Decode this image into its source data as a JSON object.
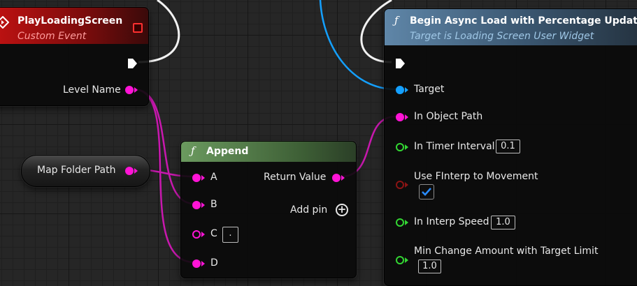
{
  "event_node": {
    "title": "PlayLoadingScreen",
    "subtitle": "Custom Event",
    "output_label": "Level Name"
  },
  "variable_node": {
    "label": "Map Folder Path"
  },
  "append_node": {
    "icon": "function-icon",
    "title": "Append",
    "inputs": [
      "A",
      "B",
      "C",
      "D"
    ],
    "c_value": ".",
    "output_label": "Return Value",
    "add_pin_label": "Add pin"
  },
  "async_node": {
    "icon": "function-icon",
    "title": "Begin Async Load with Percentage Update",
    "subtitle": "Target is Loading Screen User Widget",
    "pins": {
      "target": "Target",
      "object_path": "In Object Path",
      "timer_interval": "In Timer Interval",
      "timer_interval_value": "0.1",
      "use_finterp": "Use FInterp to Movement",
      "use_finterp_checked": true,
      "interp_speed": "In Interp Speed",
      "interp_speed_value": "1.0",
      "min_change": "Min Change Amount with Target Limit",
      "min_change_value": "1.0"
    }
  },
  "colors": {
    "string_pin": "#ff14d6",
    "object_pin": "#14a0ff",
    "float_pin": "#33d633",
    "bool_pin": "#8a1414",
    "event_header": "#b01010",
    "function_header_blue": "#4a6f90",
    "function_header_green": "#4f7a46"
  }
}
